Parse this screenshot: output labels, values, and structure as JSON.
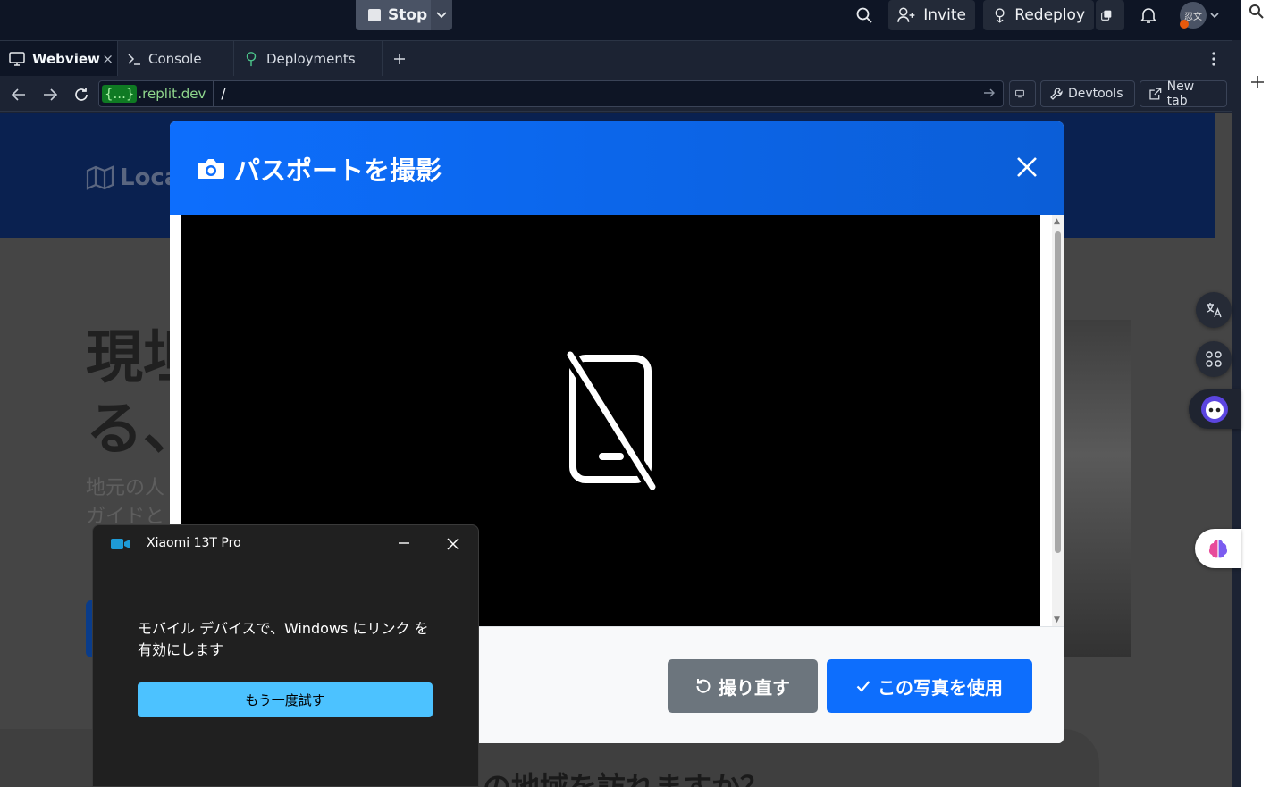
{
  "topbar": {
    "stop_label": "Stop",
    "invite_label": "Invite",
    "redeploy_label": "Redeploy",
    "avatar_text": "忍文"
  },
  "tabs": [
    {
      "label": "Webview",
      "icon": "monitor-icon"
    },
    {
      "label": "Console",
      "icon": "terminal-icon"
    },
    {
      "label": "Deployments",
      "icon": "deploy-icon"
    }
  ],
  "address": {
    "host_brace": "{...}",
    "host": ".replit.dev",
    "path": "/",
    "devtools_label": "Devtools",
    "newtab_label": "New tab"
  },
  "page": {
    "logo": "Loca",
    "hero_line1": "現坦",
    "hero_line2": "る、",
    "sub_line1": "地元の人",
    "sub_line2": "ガイドと",
    "bottom_text": "の地域を訪れますか？"
  },
  "modal": {
    "title": "パスポートを撮影",
    "retake_label": "撮り直す",
    "use_label": "この写真を使用"
  },
  "toast": {
    "device": "Xiaomi 13T Pro",
    "message": "モバイル デバイスで、Windows にリンク を有効にします",
    "retry_label": "もう一度試す"
  },
  "colors": {
    "modal_header": "#0d6efd",
    "retake_bg": "#6c757d",
    "use_bg": "#0d6efd",
    "toast_btn": "#4cc2ff"
  }
}
